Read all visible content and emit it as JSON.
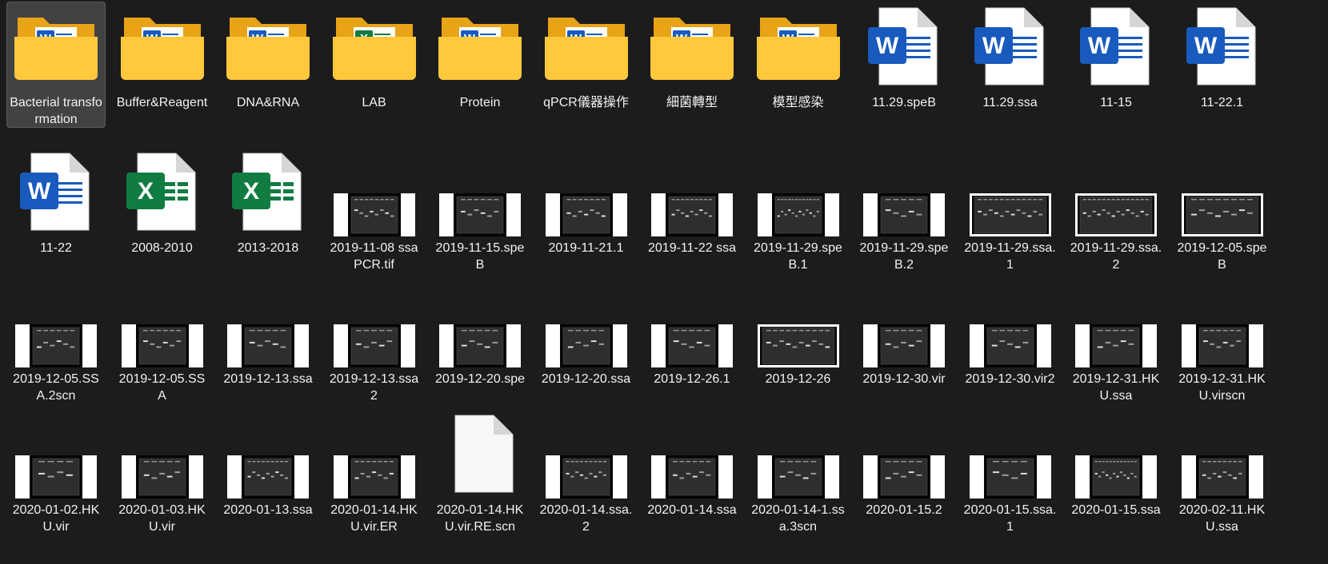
{
  "items": [
    {
      "label": "Bacterial transformation",
      "type": "folder",
      "badge": "word",
      "selected": true
    },
    {
      "label": "Buffer&Reagent",
      "type": "folder",
      "badge": "word"
    },
    {
      "label": "DNA&RNA",
      "type": "folder",
      "badge": "word"
    },
    {
      "label": "LAB",
      "type": "folder",
      "badge": "excel"
    },
    {
      "label": "Protein",
      "type": "folder",
      "badge": "word"
    },
    {
      "label": "qPCR儀器操作",
      "type": "folder",
      "badge": "word"
    },
    {
      "label": "細菌轉型",
      "type": "folder",
      "badge": "word"
    },
    {
      "label": "模型感染",
      "type": "folder",
      "badge": "word"
    },
    {
      "label": "11.29.speB",
      "type": "word"
    },
    {
      "label": "11.29.ssa",
      "type": "word"
    },
    {
      "label": "11-15",
      "type": "word"
    },
    {
      "label": "11-22.1",
      "type": "word"
    },
    {
      "label": "11-22",
      "type": "word"
    },
    {
      "label": "2008-2010",
      "type": "excel"
    },
    {
      "label": "2013-2018",
      "type": "excel"
    },
    {
      "label": "2019-11-08 ssa PCR.tif",
      "type": "gel",
      "frame": "white-sides",
      "lanes": 8
    },
    {
      "label": "2019-11-15.spe B",
      "type": "gel",
      "frame": "white-sides",
      "lanes": 6
    },
    {
      "label": "2019-11-21.1",
      "type": "gel",
      "frame": "white-sides",
      "lanes": 7
    },
    {
      "label": "2019-11-22 ssa",
      "type": "gel",
      "frame": "white-sides",
      "lanes": 9
    },
    {
      "label": "2019-11-29.spe B.1",
      "type": "gel",
      "frame": "white-sides",
      "lanes": 12
    },
    {
      "label": "2019-11-29.spe B.2",
      "type": "gel",
      "frame": "white-sides",
      "lanes": 5
    },
    {
      "label": "2019-11-29.ssa.1",
      "type": "gel",
      "frame": "white-box",
      "lanes": 12
    },
    {
      "label": "2019-11-29.ssa.2",
      "type": "gel",
      "frame": "white-box",
      "lanes": 14
    },
    {
      "label": "2019-12-05.speB",
      "type": "gel",
      "frame": "white-box",
      "lanes": 8
    },
    {
      "label": "2019-12-05.SSA.2scn",
      "type": "gel",
      "frame": "white-sides",
      "lanes": 6
    },
    {
      "label": "2019-12-05.SSA",
      "type": "gel",
      "frame": "white-sides",
      "lanes": 6
    },
    {
      "label": "2019-12-13.ssa",
      "type": "gel",
      "frame": "white-sides",
      "lanes": 5
    },
    {
      "label": "2019-12-13.ssa2",
      "type": "gel",
      "frame": "white-sides",
      "lanes": 5
    },
    {
      "label": "2019-12-20.spe",
      "type": "gel",
      "frame": "white-sides",
      "lanes": 5
    },
    {
      "label": "2019-12-20.ssa",
      "type": "gel",
      "frame": "white-sides",
      "lanes": 5
    },
    {
      "label": "2019-12-26.1",
      "type": "gel",
      "frame": "white-sides",
      "lanes": 5
    },
    {
      "label": "2019-12-26",
      "type": "gel",
      "frame": "white-box",
      "lanes": 10
    },
    {
      "label": "2019-12-30.vir",
      "type": "gel",
      "frame": "white-sides",
      "lanes": 5
    },
    {
      "label": "2019-12-30.vir2",
      "type": "gel",
      "frame": "white-sides",
      "lanes": 5
    },
    {
      "label": "2019-12-31.HKU.ssa",
      "type": "gel",
      "frame": "white-sides",
      "lanes": 5
    },
    {
      "label": "2019-12-31.HKU.virscn",
      "type": "gel",
      "frame": "white-sides",
      "lanes": 6
    },
    {
      "label": "2020-01-02.HKU.vir",
      "type": "gel",
      "frame": "white-sides",
      "lanes": 4
    },
    {
      "label": "2020-01-03.HKU.vir",
      "type": "gel",
      "frame": "white-sides",
      "lanes": 5
    },
    {
      "label": "2020-01-13.ssa",
      "type": "gel",
      "frame": "white-sides",
      "lanes": 9
    },
    {
      "label": "2020-01-14.HKU.vir.ER",
      "type": "gel",
      "frame": "white-sides",
      "lanes": 7
    },
    {
      "label": "2020-01-14.HKU.vir.RE.scn",
      "type": "blank"
    },
    {
      "label": "2020-01-14.ssa.2",
      "type": "gel",
      "frame": "white-sides",
      "lanes": 9
    },
    {
      "label": "2020-01-14.ssa",
      "type": "gel",
      "frame": "white-sides",
      "lanes": 6
    },
    {
      "label": "2020-01-14-1.ssa.3scn",
      "type": "gel",
      "frame": "white-sides",
      "lanes": 5
    },
    {
      "label": "2020-01-15.2",
      "type": "gel",
      "frame": "white-sides",
      "lanes": 5
    },
    {
      "label": "2020-01-15.ssa.1",
      "type": "gel",
      "frame": "white-sides",
      "lanes": 4
    },
    {
      "label": "2020-01-15.ssa",
      "type": "gel",
      "frame": "white-sides",
      "lanes": 12
    },
    {
      "label": "2020-02-11.HKU.ssa",
      "type": "gel",
      "frame": "white-sides",
      "lanes": 8
    }
  ],
  "colors": {
    "background": "#1c1c1c",
    "folder_back": "#e8a317",
    "folder_front": "#ffc83d",
    "word_blue": "#185abd",
    "excel_green": "#107c41",
    "doc_white": "#ffffff"
  }
}
